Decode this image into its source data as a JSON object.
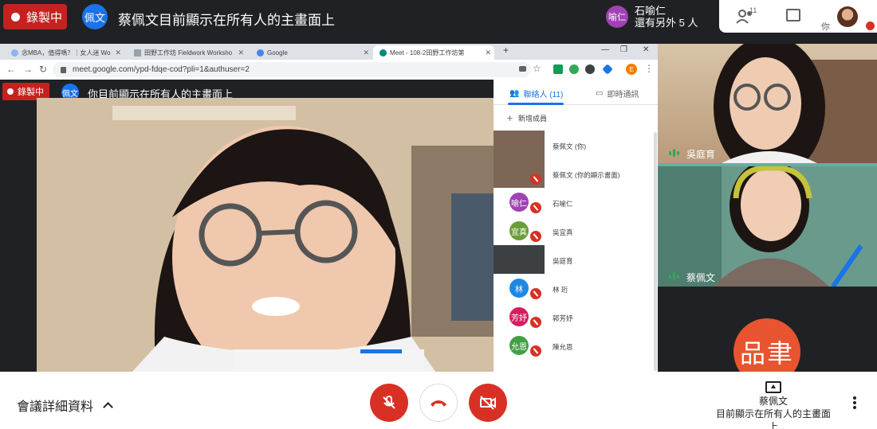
{
  "top_bar": {
    "recording_label": "錄製中",
    "presenter_avatar": "佩文",
    "presenting_text": "蔡佩文目前顯示在所有人的主畫面上",
    "participant_avatar": "喻仁",
    "participant_name": "石喻仁",
    "others_text": "還有另外 5 人",
    "people_count": "11",
    "me_label": "你"
  },
  "browser": {
    "tabs": [
      {
        "label": "念MBA，值得嗎？｜女人迷 Wo",
        "favicon_color": "#8ab4f8"
      },
      {
        "label": "田野工作坊 Fieldwork Worksho",
        "favicon_color": "#9aa0a6"
      },
      {
        "label": "Google",
        "favicon_color": "#4285f4"
      },
      {
        "label": "Meet - 108-2田野工作坊第",
        "favicon_color": "#00897b"
      }
    ],
    "url": "meet.google.com/ypd-fdqe-cod?pli=1&authuser=2",
    "profile_initial": "E",
    "new_tab": "+",
    "minimize": "—",
    "restore": "❐",
    "close": "✕"
  },
  "inner_meet": {
    "recording_label": "錄製中",
    "presenter_avatar": "佩文",
    "presenting_text": "你目前顯示在所有人的主畫面上"
  },
  "sidebar": {
    "contacts_tab": "聯絡人 (11)",
    "chat_tab": "即時通訊",
    "add_member": "新增成員",
    "people": [
      {
        "name": "蔡佩文 (你)",
        "avatar": "",
        "color": "#8d6e63",
        "muted": false
      },
      {
        "name": "蔡佩文 (你的顯示畫面)",
        "avatar": "",
        "color": "#6d5a4a",
        "muted": true
      },
      {
        "name": "石喻仁",
        "avatar": "喻仁",
        "color": "#a142b4",
        "muted": true
      },
      {
        "name": "吳宜真",
        "avatar": "宜真",
        "color": "#689f38",
        "muted": true
      },
      {
        "name": "吳庭育",
        "avatar": "",
        "color": "#3c4043",
        "muted": false
      },
      {
        "name": "林 珩",
        "avatar": "林",
        "color": "#1e88e5",
        "muted": true
      },
      {
        "name": "郭芳妤",
        "avatar": "芳妤",
        "color": "#d81b60",
        "muted": true
      },
      {
        "name": "陳允恩",
        "avatar": "允恩",
        "color": "#43a047",
        "muted": true
      }
    ]
  },
  "tiles": [
    {
      "name": "吳庭育"
    },
    {
      "name": "蔡佩文"
    },
    {
      "avatar": "品聿",
      "color": "#e8542f"
    }
  ],
  "bottom_bar": {
    "meeting_details": "會議詳細資料",
    "present_name": "蔡佩文",
    "present_status": "目前顯示在所有人的主畫面上"
  }
}
